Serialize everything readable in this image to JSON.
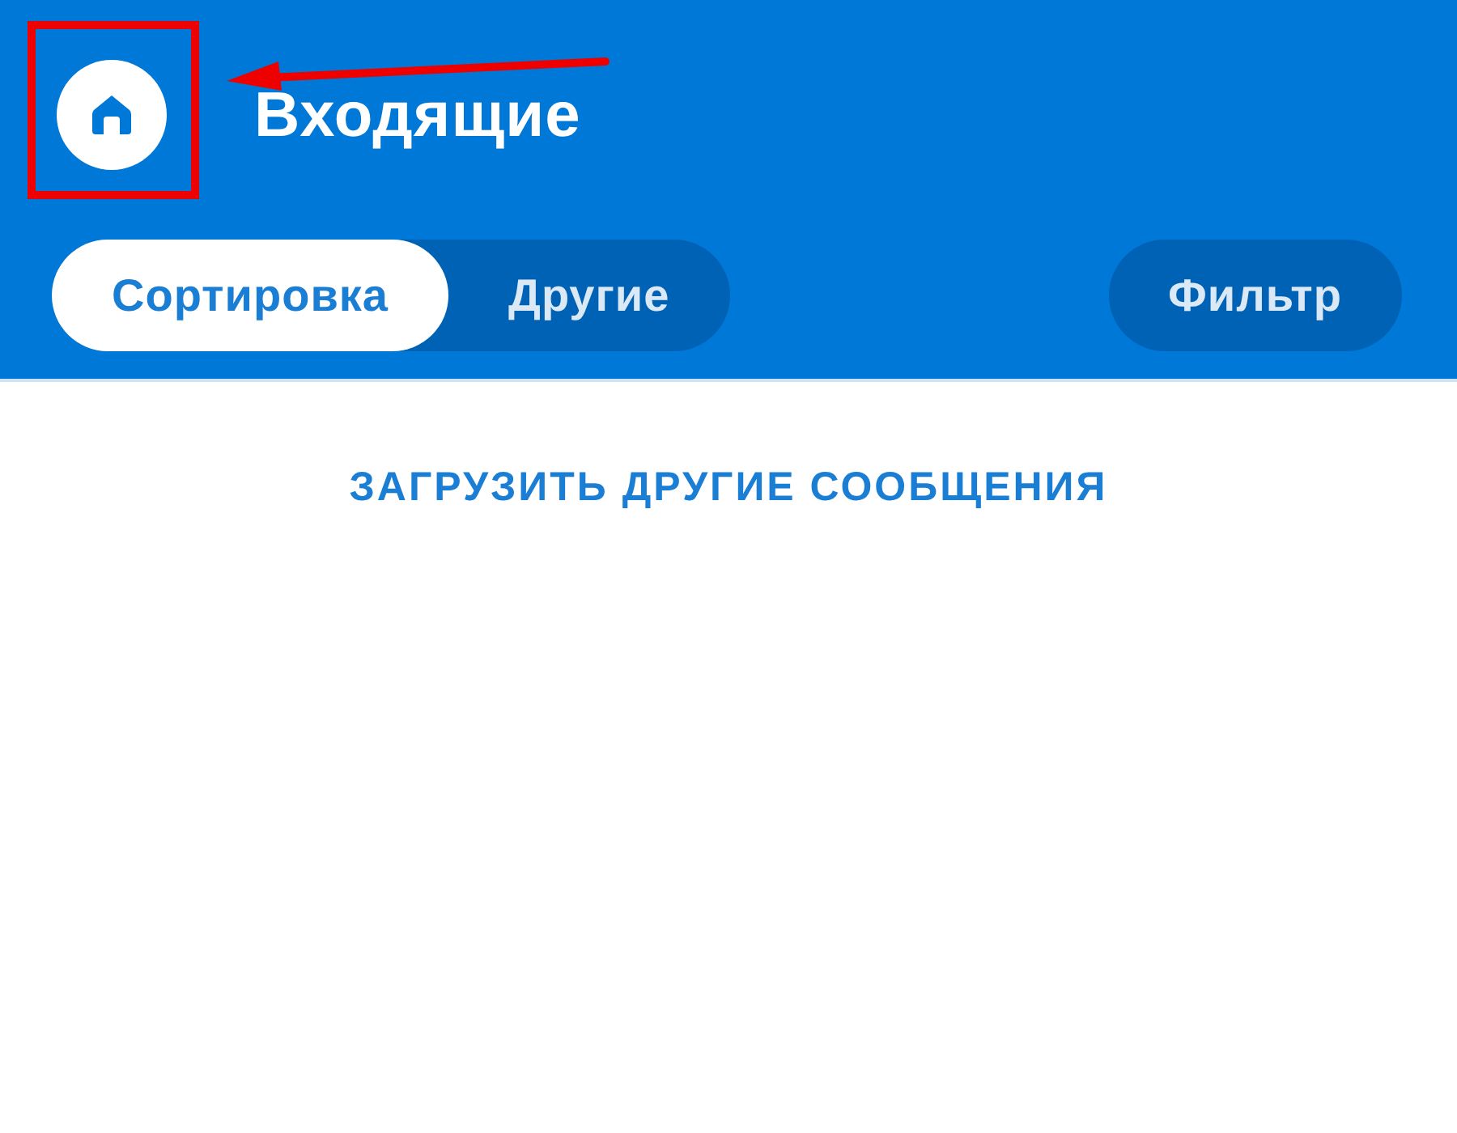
{
  "header": {
    "title": "Входящие"
  },
  "tabs": [
    {
      "label": "Сортировка",
      "selected": true
    },
    {
      "label": "Другие",
      "selected": false
    }
  ],
  "filter_button": {
    "label": "Фильтр"
  },
  "load_more": {
    "label": "ЗАГРУЗИТЬ ДРУГИЕ СООБЩЕНИЯ"
  },
  "annotation": {
    "highlight_box": true,
    "arrow": true
  }
}
